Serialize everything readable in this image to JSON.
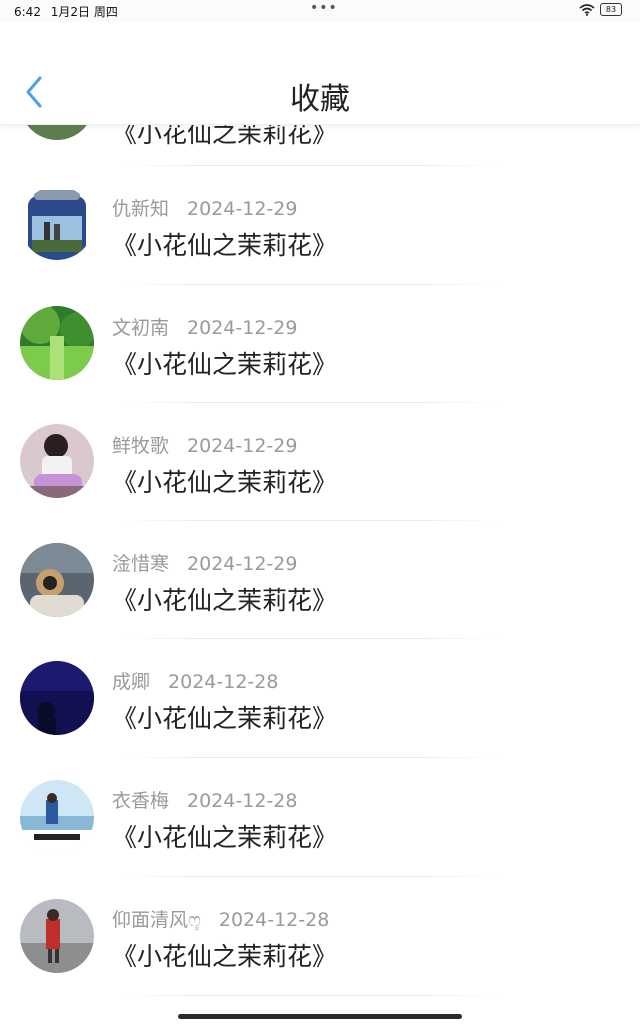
{
  "status_bar": {
    "time": "6:42",
    "date": "1月2日 周四",
    "menu_dots": "•••",
    "battery": "83"
  },
  "header": {
    "title": "收藏",
    "back_icon": "chevron-left-icon"
  },
  "colors": {
    "back_icon": "#4a9fe8",
    "meta_text": "#9a9a9a",
    "title_text": "#222222"
  },
  "items": [
    {
      "name": "",
      "date": "",
      "title": "《小花仙之茉莉花》"
    },
    {
      "name": "仇新知",
      "date": "2024-12-29",
      "title": "《小花仙之茉莉花》"
    },
    {
      "name": "文初南",
      "date": "2024-12-29",
      "title": "《小花仙之茉莉花》"
    },
    {
      "name": "鲜牧歌",
      "date": "2024-12-29",
      "title": "《小花仙之茉莉花》"
    },
    {
      "name": "淦惜寒",
      "date": "2024-12-29",
      "title": "《小花仙之茉莉花》"
    },
    {
      "name": "成卿",
      "date": "2024-12-28",
      "title": "《小花仙之茉莉花》"
    },
    {
      "name": "衣香梅",
      "date": "2024-12-28",
      "title": "《小花仙之茉莉花》"
    },
    {
      "name": "仰面清风ෆ͙",
      "date": "2024-12-28",
      "title": "《小花仙之茉莉花》"
    }
  ]
}
